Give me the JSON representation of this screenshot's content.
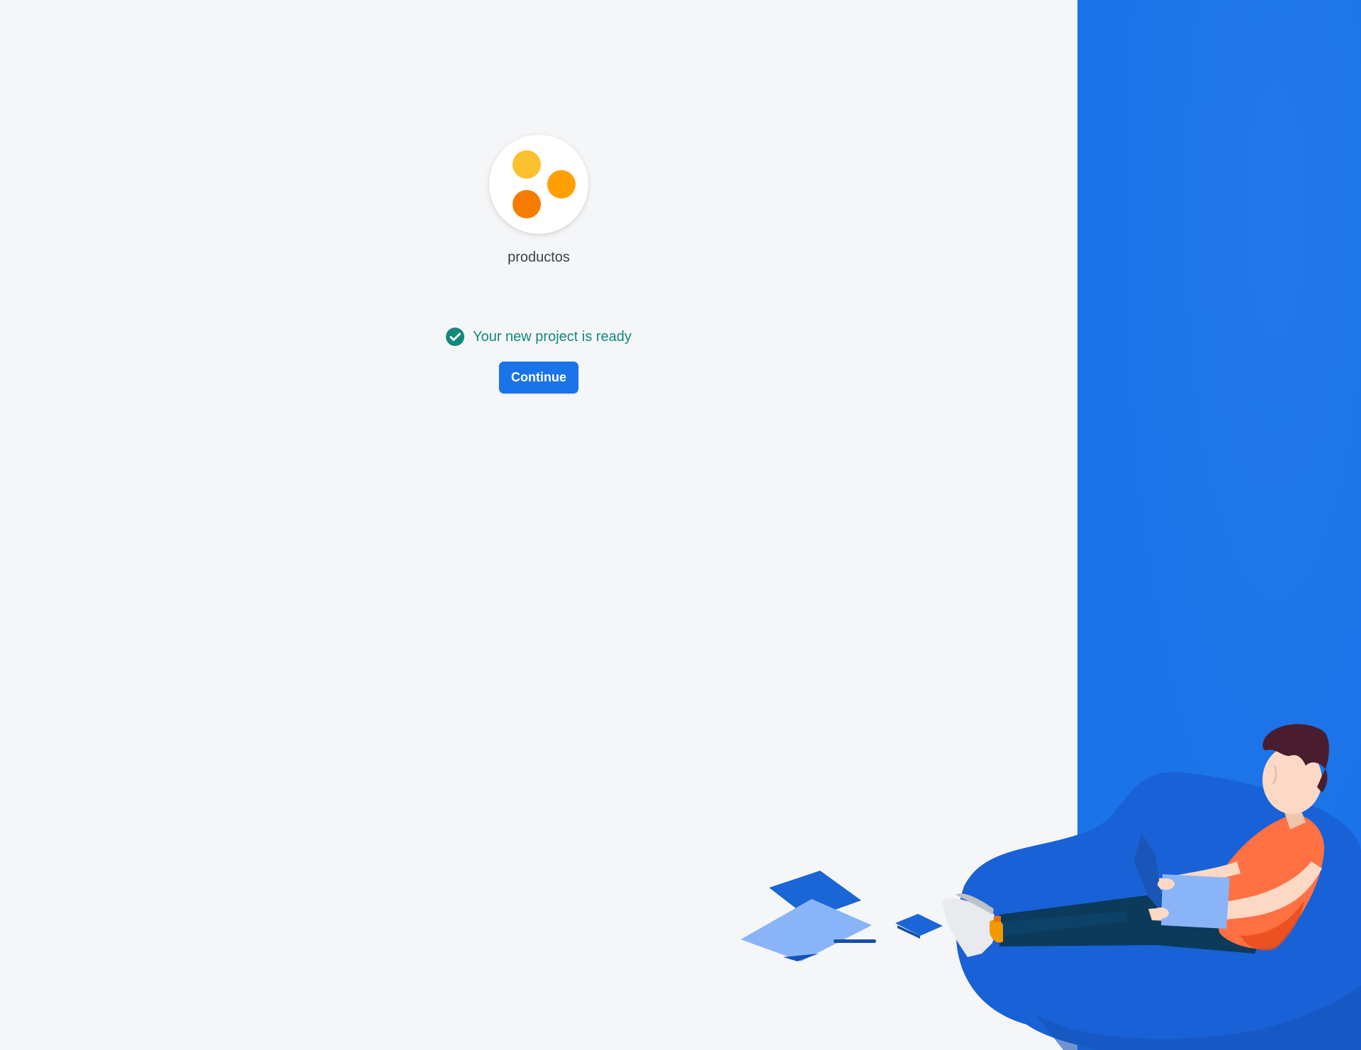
{
  "project": {
    "name": "productos",
    "avatar_colors": [
      "#fbc02d",
      "#ffa000",
      "#f57c00"
    ]
  },
  "status": {
    "message": "Your new project is ready",
    "icon": "check-circle-icon",
    "color": "#12897a"
  },
  "actions": {
    "continue_label": "Continue"
  },
  "theme": {
    "accent": "#1a73e8",
    "background": "#f5f6f8"
  }
}
